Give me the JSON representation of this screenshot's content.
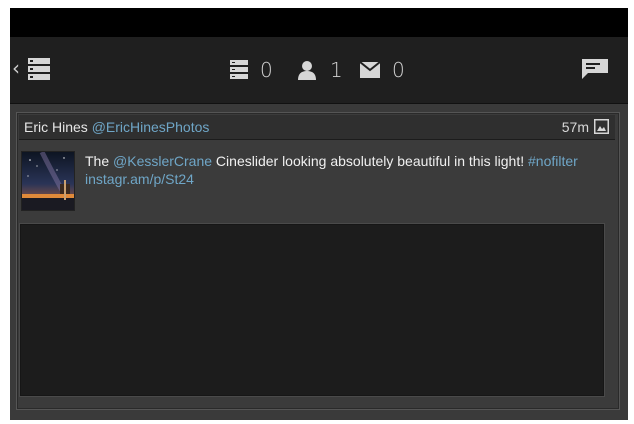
{
  "actionbar": {
    "back_icon": "chevron-left-icon",
    "nav_icon": "stacked-list-icon",
    "counters": [
      {
        "icon": "list-icon",
        "value": "0"
      },
      {
        "icon": "person-icon",
        "value": "1"
      },
      {
        "icon": "envelope-icon",
        "value": "0"
      }
    ],
    "compose_icon": "compose-icon"
  },
  "tweet": {
    "author_name": "Eric Hines",
    "author_handle": "@EricHinesPhotos",
    "timestamp": "57m",
    "media_icon": "image-icon",
    "text_prefix": "The ",
    "mention": "@KesslerCrane",
    "text_middle": " Cineslider looking absolutely beautiful in this light! ",
    "hashtag": "#nofilter",
    "link": "instagr.am/p/St24"
  },
  "colors": {
    "background": "#1d1d1d",
    "card": "#3b3b3b",
    "link": "#6fa6c7",
    "text": "#f0f0f0"
  }
}
